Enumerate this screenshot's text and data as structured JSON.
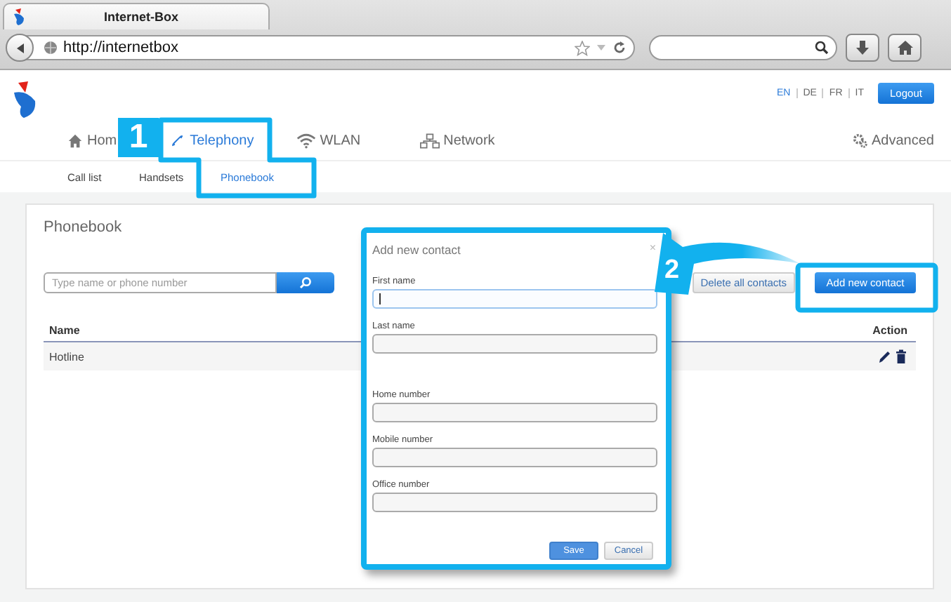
{
  "browser": {
    "tab_title": "Internet-Box",
    "address": "http://internetbox"
  },
  "header": {
    "languages": [
      {
        "label": "EN",
        "selected": true
      },
      {
        "label": "DE",
        "selected": false
      },
      {
        "label": "FR",
        "selected": false
      },
      {
        "label": "IT",
        "selected": false
      }
    ],
    "logout": "Logout"
  },
  "nav": [
    {
      "label": "Hom",
      "selected": false
    },
    {
      "label": "Telephony",
      "selected": true
    },
    {
      "label": "WLAN",
      "selected": false
    },
    {
      "label": "Network",
      "selected": false
    },
    {
      "label": "Advanced",
      "selected": false
    }
  ],
  "subnav": [
    {
      "label": "Call list",
      "selected": false
    },
    {
      "label": "Handsets",
      "selected": false
    },
    {
      "label": "Phonebook",
      "selected": true
    }
  ],
  "panel": {
    "title": "Phonebook",
    "search": {
      "placeholder": "Type name or phone number"
    },
    "delete_all": "Delete all contacts",
    "add_new": "Add new contact",
    "table": {
      "columns": [
        "Name",
        "Action"
      ],
      "rows": [
        {
          "name": "Hotline"
        }
      ]
    }
  },
  "dialog": {
    "title": "Add new contact",
    "close": "×",
    "fields": [
      {
        "label": "First name",
        "focused": true
      },
      {
        "label": "Last name",
        "focused": false
      },
      {
        "label": "Home number",
        "focused": false
      },
      {
        "label": "Mobile number",
        "focused": false
      },
      {
        "label": "Office number",
        "focused": false
      }
    ],
    "buttons": [
      {
        "label": "Save",
        "kind": "primary"
      },
      {
        "label": "Cancel",
        "kind": "secondary"
      }
    ]
  },
  "annotations": [
    {
      "label": "1"
    },
    {
      "label": "2"
    }
  ]
}
